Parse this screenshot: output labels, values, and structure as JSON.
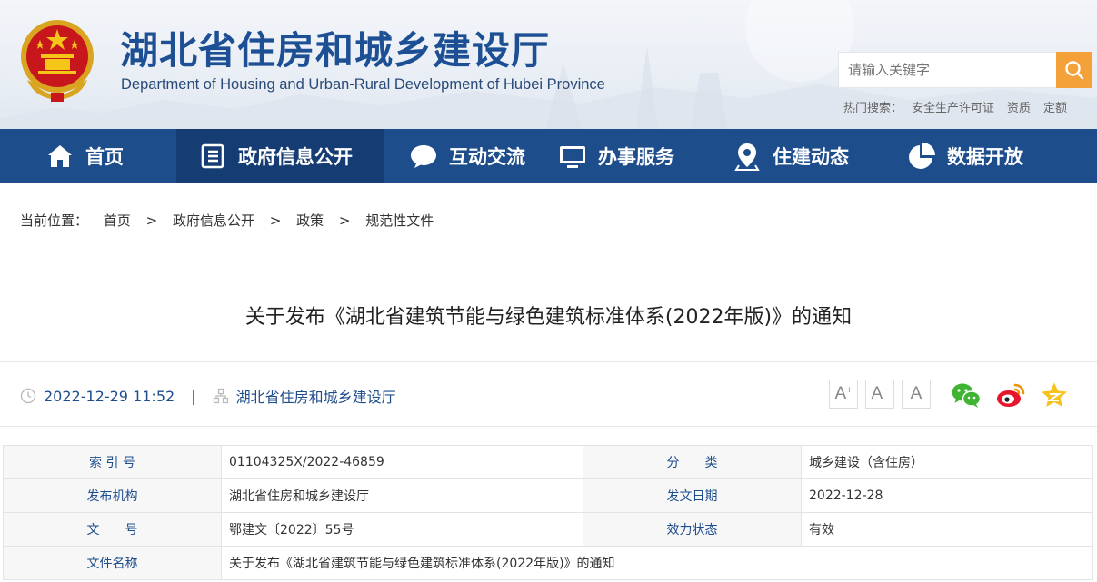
{
  "header": {
    "title": "湖北省住房和城乡建设厅",
    "subtitle": "Department of Housing and Urban-Rural Development of Hubei Province",
    "search_placeholder": "请输入关键字",
    "hot_label": "热门搜索：",
    "hot_terms": [
      "安全生产许可证",
      "资质",
      "定额"
    ]
  },
  "nav": {
    "items": [
      {
        "label": "首页",
        "icon": "home-icon"
      },
      {
        "label": "政府信息公开",
        "icon": "document-list-icon"
      },
      {
        "label": "互动交流",
        "icon": "chat-bubble-icon"
      },
      {
        "label": "办事服务",
        "icon": "monitor-icon"
      },
      {
        "label": "住建动态",
        "icon": "location-pin-icon"
      },
      {
        "label": "数据开放",
        "icon": "pie-chart-icon"
      }
    ],
    "active_index": 1
  },
  "breadcrumb": {
    "label": "当前位置：",
    "items": [
      "首页",
      "政府信息公开",
      "政策",
      "规范性文件"
    ],
    "separator": ">"
  },
  "article": {
    "title": "关于发布《湖北省建筑节能与绿色建筑标准体系(2022年版)》的通知",
    "datetime": "2022-12-29 11:52",
    "divider": "|",
    "source": "湖北省住房和城乡建设厅"
  },
  "font_controls": {
    "increase": "A",
    "decrease": "A",
    "reset": "A",
    "plus": "+",
    "minus": "−"
  },
  "share": [
    "wechat-icon",
    "weibo-icon",
    "favorite-star-icon"
  ],
  "info_table": {
    "rows": [
      {
        "k1": "索 引 号",
        "v1": "01104325X/2022-46859",
        "k2": "分　　类",
        "v2": "城乡建设（含住房）"
      },
      {
        "k1": "发布机构",
        "v1": "湖北省住房和城乡建设厅",
        "k2": "发文日期",
        "v2": "2022-12-28"
      },
      {
        "k1": "文　　号",
        "v1": "鄂建文〔2022〕55号",
        "k2": "效力状态",
        "v2": "有效"
      }
    ],
    "name_label": "文件名称",
    "name_value": "关于发布《湖北省建筑节能与绿色建筑标准体系(2022年版)》的通知"
  },
  "colors": {
    "nav_bg": "#1e4d8c",
    "nav_active": "#163d73",
    "accent": "#f4a13a",
    "title_blue": "#1c4f93"
  }
}
